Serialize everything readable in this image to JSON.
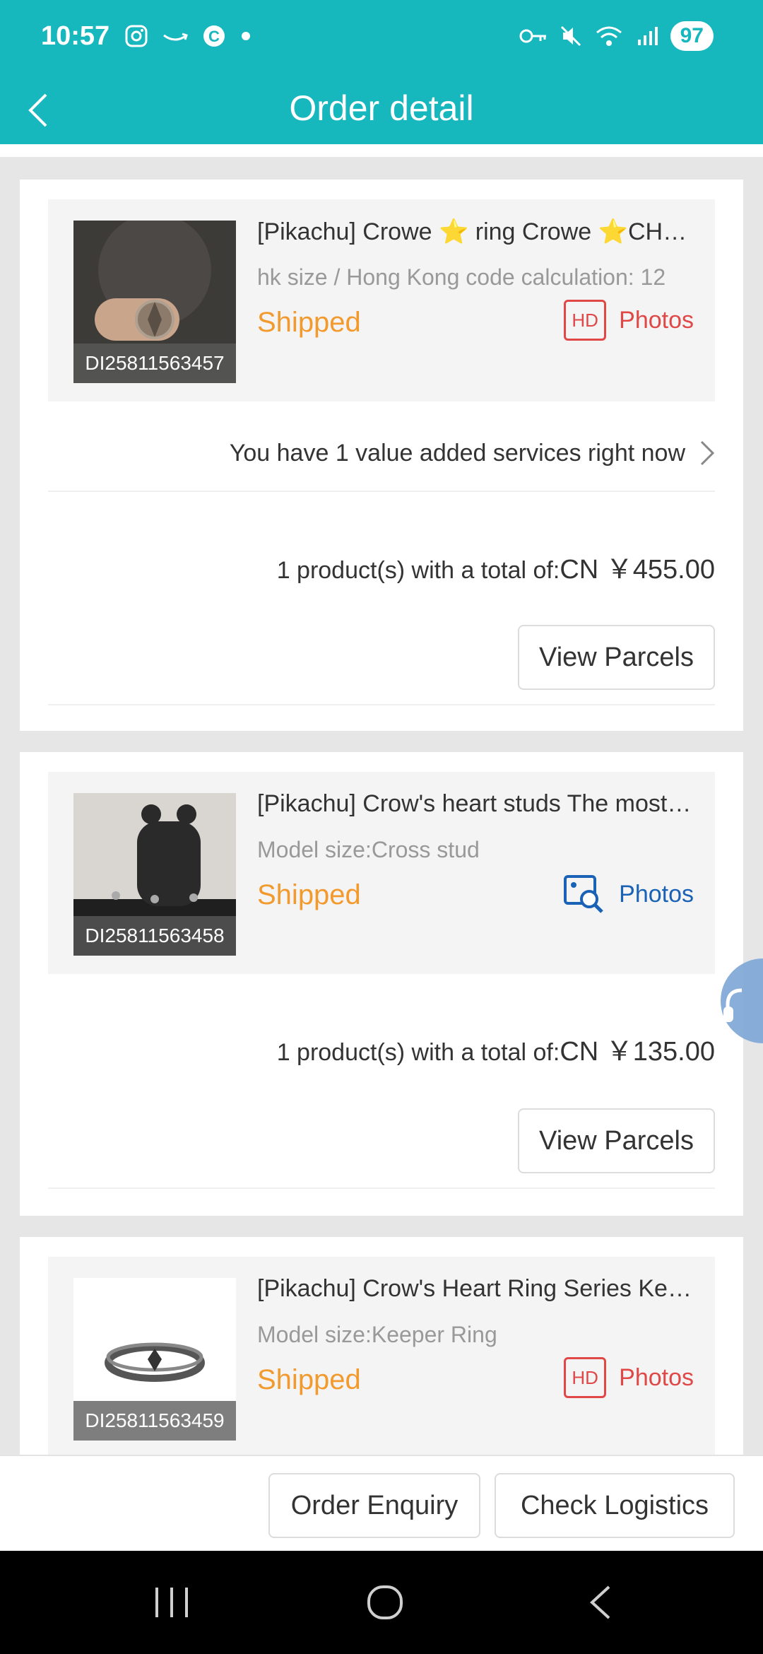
{
  "status_bar": {
    "time": "10:57",
    "battery": "97"
  },
  "header": {
    "title": "Order detail"
  },
  "orders": [
    {
      "title": "[Pikachu] Crowe ⭐ ring Crowe ⭐CHROME HEARTS",
      "size": "hk size / Hong Kong code calculation: 12",
      "status": "Shipped",
      "photos": "Photos",
      "hd": "HD",
      "code": "DI25811563457",
      "vas": "You have 1 value added services right now",
      "total_prefix": "1 product(s) with a total of:",
      "total_amount": "CN ￥455.00",
      "button": "View Parcels"
    },
    {
      "title": "[Pikachu] Crow's heart studs The most classic",
      "size": "Model size:Cross stud",
      "status": "Shipped",
      "photos": "Photos",
      "code": "DI25811563458",
      "total_prefix": "1 product(s) with a total of:",
      "total_amount": "CN ￥135.00",
      "button": "View Parcels"
    },
    {
      "title": "[Pikachu] Crow's Heart Ring Series Keeper",
      "size": "Model size:Keeper Ring",
      "status": "Shipped",
      "photos": "Photos",
      "hd": "HD",
      "code": "DI25811563459"
    }
  ],
  "bottom_bar": {
    "enquiry": "Order Enquiry",
    "logistics": "Check Logistics"
  },
  "colors": {
    "accent": "#17b7be",
    "shipped": "#f29a2e",
    "photos_red": "#e04848",
    "photos_blue": "#1a62b5"
  }
}
